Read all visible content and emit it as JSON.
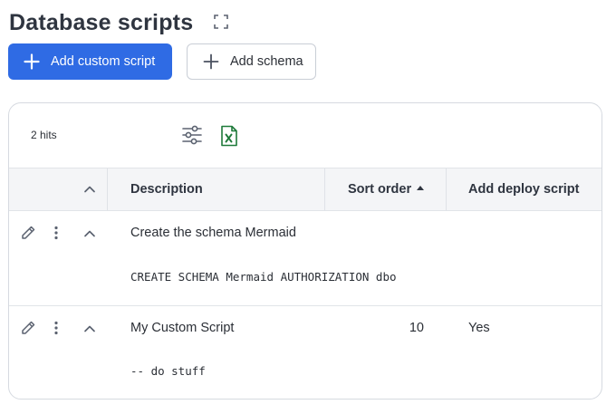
{
  "page": {
    "title": "Database scripts"
  },
  "toolbar": {
    "add_custom_script_label": "Add custom script",
    "add_schema_label": "Add schema"
  },
  "results": {
    "hits": "2 hits"
  },
  "table": {
    "columns": {
      "description": "Description",
      "sort_order": "Sort order",
      "add_deploy_script": "Add deploy script"
    },
    "sorted_by": "sort_order",
    "sort_direction": "ascending",
    "rows": [
      {
        "description": "Create the schema Mermaid",
        "sort_order": "",
        "add_deploy_script": "",
        "script": "CREATE SCHEMA Mermaid AUTHORIZATION dbo"
      },
      {
        "description": "My Custom Script",
        "sort_order": "10",
        "add_deploy_script": "Yes",
        "script": "-- do stuff"
      }
    ]
  },
  "colors": {
    "primary": "#2f6be4",
    "excel_green": "#1f7a3a",
    "header_bg": "#f4f5f7",
    "icon_gray": "#6b7280"
  }
}
